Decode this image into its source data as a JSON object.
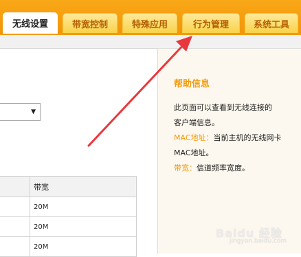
{
  "nav": {
    "tabs": [
      {
        "label": "无线设置",
        "active": true
      },
      {
        "label": "带宽控制",
        "active": false
      },
      {
        "label": "特殊应用",
        "active": false
      },
      {
        "label": "行为管理",
        "active": false
      },
      {
        "label": "系统工具",
        "active": false
      }
    ]
  },
  "main": {
    "select": {
      "value": "",
      "arrow": "▼"
    },
    "table": {
      "header": {
        "col1": "",
        "col2": "带宽"
      },
      "rows": [
        {
          "col1": "",
          "bandwidth": "20M"
        },
        {
          "col1": "",
          "bandwidth": "20M"
        },
        {
          "col1": "",
          "bandwidth": "20M"
        }
      ]
    }
  },
  "help": {
    "title": "帮助信息",
    "line1": "此页面可以查看到无线连接的",
    "line2": "客户端信息。",
    "mac_key": "MAC地址：",
    "mac_desc": "当前主机的无线网卡",
    "mac_desc2": "MAC地址。",
    "bw_key": "带宽：",
    "bw_desc": "信道频率宽度。"
  },
  "watermark": {
    "text": "Baidu 经验",
    "sub": "jingyan.baidu.com"
  },
  "colors": {
    "accent": "#f39a0d",
    "arrow": "#e8383d",
    "tab_text": "#b35f00"
  }
}
